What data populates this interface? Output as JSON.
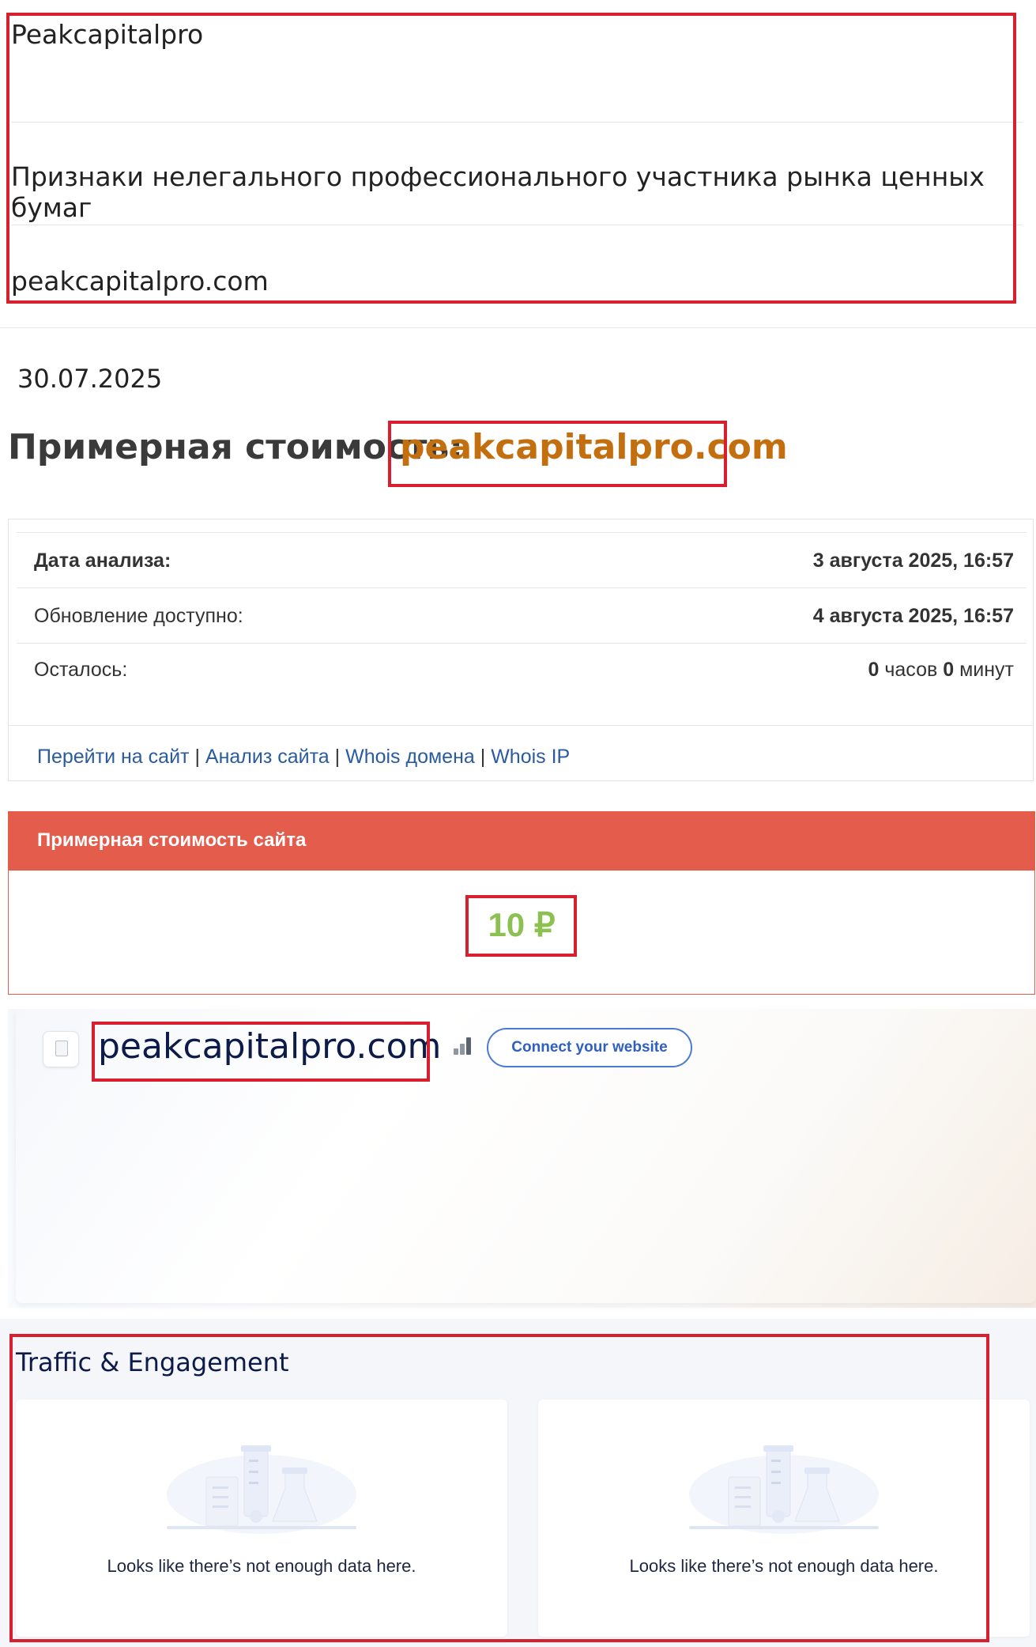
{
  "info": {
    "company": "Peakcapitalpro",
    "description": "Признаки нелегального профессионального участника рынка ценных бумаг",
    "domain": "peakcapitalpro.com"
  },
  "date": "30.07.2025",
  "estimate": {
    "title": "Примерная стоимость:",
    "domain": "peakcapitalpro.com"
  },
  "analysis": {
    "rows": [
      {
        "label": "Дата анализа:",
        "value": "3 августа 2025, 16:57"
      },
      {
        "label": "Обновление доступно:",
        "value": "4 августа 2025, 16:57"
      },
      {
        "label": "Осталось:",
        "hours_num": "0",
        "hours_word": "часов",
        "minutes_num": "0",
        "minutes_word": "минут"
      }
    ],
    "links": [
      "Перейти на сайт",
      "Анализ сайта",
      "Whois домена",
      "Whois IP"
    ],
    "separator": "|"
  },
  "cost": {
    "header": "Примерная стоимость сайта",
    "value": "10 ₽"
  },
  "site": {
    "domain": "peakcapitalpro.com",
    "connect_label": "Connect your website",
    "icons": [
      "page-icon",
      "bar-chart-icon"
    ]
  },
  "traffic": {
    "title": "Traffic & Engagement",
    "cards": [
      {
        "message": "Looks like there’s not enough data here."
      },
      {
        "message": "Looks like there’s not enough data here."
      }
    ]
  },
  "colors": {
    "highlight_box": "#d71f2f",
    "cost_header": "#e45c4c",
    "cost_value": "#8cc152",
    "estimate_domain": "#c36f0f",
    "link": "#2a5b9e",
    "connect_button": "#4a7ad6"
  }
}
